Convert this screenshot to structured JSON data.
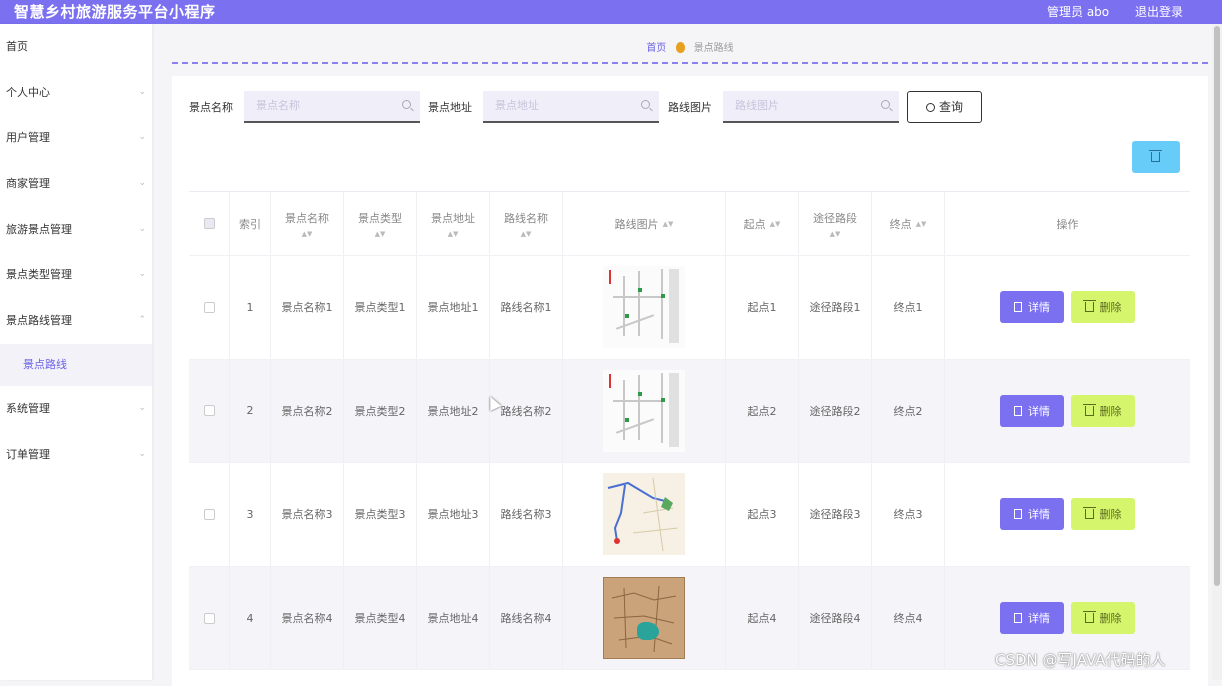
{
  "app": {
    "title": "智慧乡村旅游服务平台小程序",
    "user_label": "管理员 abo",
    "logout_label": "退出登录",
    "accent_color": "#7b70f0"
  },
  "sidebar": {
    "items": [
      {
        "label": "首页",
        "has_chevron": false
      },
      {
        "label": "个人中心",
        "has_chevron": true
      },
      {
        "label": "用户管理",
        "has_chevron": true
      },
      {
        "label": "商家管理",
        "has_chevron": true
      },
      {
        "label": "旅游景点管理",
        "has_chevron": true
      },
      {
        "label": "景点类型管理",
        "has_chevron": true
      },
      {
        "label": "景点路线管理",
        "has_chevron": true,
        "expanded": true
      }
    ],
    "active_submenu": "景点路线",
    "items_after": [
      {
        "label": "系统管理"
      },
      {
        "label": "订单管理"
      }
    ]
  },
  "breadcrumb": {
    "home": "首页",
    "current": "景点路线"
  },
  "search": {
    "fields": [
      {
        "label": "景点名称",
        "placeholder": "景点名称"
      },
      {
        "label": "景点地址",
        "placeholder": "景点地址"
      },
      {
        "label": "路线图片",
        "placeholder": "路线图片"
      }
    ],
    "query_label": "查询"
  },
  "table": {
    "headers": [
      "索引",
      "景点名称",
      "景点类型",
      "景点地址",
      "路线名称",
      "路线图片",
      "起点",
      "途径路段",
      "终点",
      "操作"
    ],
    "rows": [
      {
        "index": "1",
        "name": "景点名称1",
        "type": "景点类型1",
        "address": "景点地址1",
        "route": "路线名称1",
        "image": "route-map",
        "start": "起点1",
        "via": "途径路段1",
        "end": "终点1"
      },
      {
        "index": "2",
        "name": "景点名称2",
        "type": "景点类型2",
        "address": "景点地址2",
        "route": "路线名称2",
        "image": "route-map",
        "start": "起点2",
        "via": "途径路段2",
        "end": "终点2"
      },
      {
        "index": "3",
        "name": "景点名称3",
        "type": "景点类型3",
        "address": "景点地址3",
        "route": "路线名称3",
        "image": "road-map",
        "start": "起点3",
        "via": "途径路段3",
        "end": "终点3"
      },
      {
        "index": "4",
        "name": "景点名称4",
        "type": "景点类型4",
        "address": "景点地址4",
        "route": "路线名称4",
        "image": "scenic-map",
        "start": "起点4",
        "via": "途径路段4",
        "end": "终点4"
      }
    ],
    "detail_label": "详情",
    "delete_label": "删除"
  },
  "watermark": "CSDN @写JAVA代码的人"
}
